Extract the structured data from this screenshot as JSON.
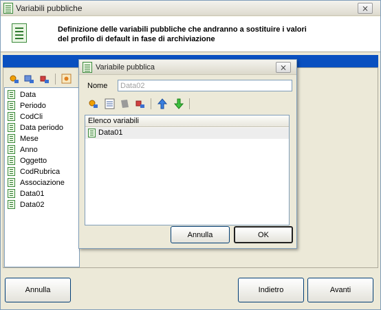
{
  "window": {
    "title": "Variabili pubbliche",
    "close_label": "⨯",
    "description_line1": "Definizione delle variabili pubbliche che andranno a sostituire i valori",
    "description_line2": "del profilo di default in fase di archiviazione"
  },
  "tree": {
    "items": [
      "Data",
      "Periodo",
      "CodCli",
      "Data periodo",
      "Mese",
      "Anno",
      "Oggetto",
      "CodRubrica",
      "Associazione",
      "Data01",
      "Data02"
    ]
  },
  "footer": {
    "cancel_label": "Annulla",
    "back_label": "Indietro",
    "next_label": "Avanti"
  },
  "dialog": {
    "title": "Variabile pubblica",
    "close_label": "⨯",
    "name_label": "Nome",
    "name_value": "Data02",
    "list_header": "Elenco variabili",
    "list_items": [
      "Data01"
    ],
    "cancel_label": "Annulla",
    "ok_label": "OK"
  },
  "colors": {
    "accent_bar": "#0a50c0",
    "window_bg": "#ece9d8",
    "icon_green": "#3c8a3c"
  },
  "icons": [
    "document-green-icon",
    "add-icon",
    "edit-icon",
    "delete-icon",
    "properties-icon",
    "list-icon",
    "arrow-up-icon",
    "arrow-down-icon"
  ]
}
